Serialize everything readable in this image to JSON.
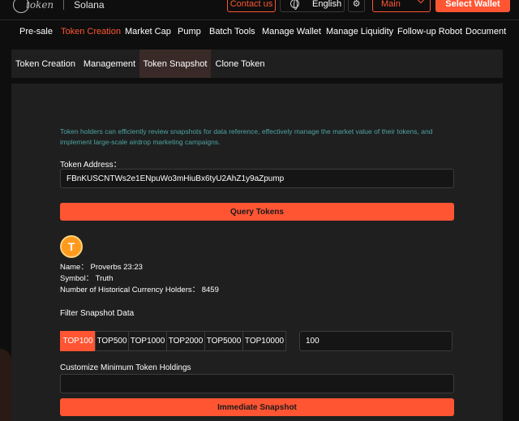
{
  "header": {
    "logo_word": "token",
    "chain": "Solana",
    "contact_label": "Contact us",
    "language": "English",
    "network": "Main",
    "wallet_label": "Select Wallet"
  },
  "nav": {
    "items": [
      "Pre-sale",
      "Token Creation",
      "Market Cap",
      "Pump",
      "Batch Tools",
      "Manage Wallet",
      "Manage Liquidity",
      "Follow-up Robot",
      "Document"
    ],
    "active_index": 1
  },
  "subtabs": {
    "items": [
      "Token Creation",
      "Management",
      "Token Snapshot",
      "Clone Token"
    ],
    "active_index": 2
  },
  "snapshot": {
    "description": "Token holders can efficiently review snapshots for data reference, effectively manage the market value of their tokens, and implement large-scale airdrop marketing campaigns.",
    "address_label": "Token Address：",
    "address_value": "FBnKUSCNTWs2e1ENpuWo3mHiuBx6tyU2AhZ1y9aZpump",
    "query_label": "Query Tokens",
    "token_initial": "T",
    "name_line": "Name： Proverbs 23:23",
    "symbol_line": "Symbol： Truth",
    "holders_line": "Number of Historical Currency Holders： 8459",
    "filter_label": "Filter Snapshot Data",
    "filters": [
      "TOP100",
      "TOP500",
      "TOP1000",
      "TOP2000",
      "TOP5000",
      "TOP10000"
    ],
    "active_filter": 0,
    "count_value": "100",
    "min_label": "Customize Minimum Token Holdings",
    "min_value": "",
    "snapshot_label": "Immediate Snapshot"
  },
  "colors": {
    "accent": "#ff5533",
    "background": "#0e0e0e",
    "panel": "#1f1f1f",
    "description_text": "#4fa3a3"
  }
}
